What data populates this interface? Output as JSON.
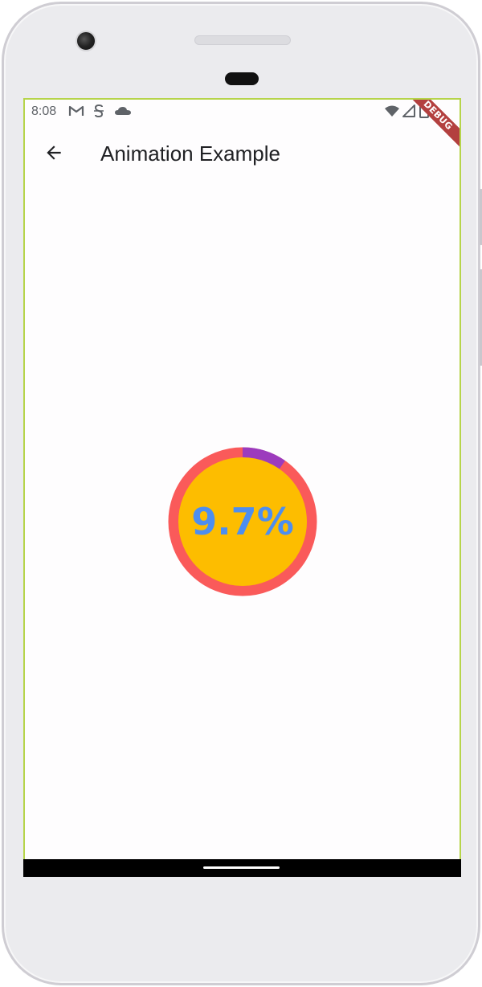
{
  "status_bar": {
    "time": "8:08",
    "left_icons": [
      "gmail-icon",
      "sim-icon",
      "cloud-icon"
    ],
    "right_icons": [
      "wifi-icon",
      "signal-icon",
      "battery-icon"
    ]
  },
  "app_bar": {
    "title": "Animation Example",
    "back_icon": "arrow-back-icon"
  },
  "debug_banner": {
    "text": "DEBUG"
  },
  "progress": {
    "label": "9.7%",
    "value": 0.097,
    "ring_color": "#fa5a5a",
    "progress_color": "#9c3bbd",
    "fill_color": "#fdbd00",
    "text_color": "#4d8ef0"
  }
}
